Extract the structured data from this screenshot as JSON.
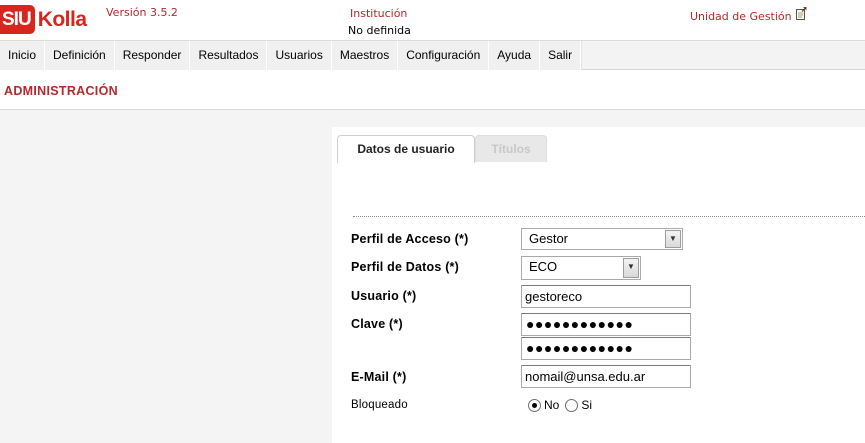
{
  "header": {
    "logo_left": "SIU",
    "logo_right": "Kolla",
    "version": "Versión 3.5.2",
    "institution_label": "Institución",
    "institution_value": "No definida",
    "unit_label": "Unidad de Gestión",
    "unit_icon": "edit-note-icon"
  },
  "menu": {
    "items": [
      {
        "label": "Inicio"
      },
      {
        "label": "Definición"
      },
      {
        "label": "Responder"
      },
      {
        "label": "Resultados"
      },
      {
        "label": "Usuarios"
      },
      {
        "label": "Maestros"
      },
      {
        "label": "Configuración"
      },
      {
        "label": "Ayuda"
      },
      {
        "label": "Salir"
      }
    ]
  },
  "page": {
    "title": "ADMINISTRACIÓN"
  },
  "tabs": {
    "active": "Datos de usuario",
    "inactive": "Títulos"
  },
  "form": {
    "perfil_acceso": {
      "label": "Perfil de Acceso (*)",
      "value": "Gestor"
    },
    "perfil_datos": {
      "label": "Perfil de Datos (*)",
      "value": "ECO"
    },
    "usuario": {
      "label": "Usuario (*)",
      "value": "gestoreco"
    },
    "clave": {
      "label": "Clave (*)",
      "value": "●●●●●●●●●●●●",
      "confirm_value": "●●●●●●●●●●●●"
    },
    "email": {
      "label": "E-Mail (*)",
      "value": "nomail@unsa.edu.ar"
    },
    "bloqueado": {
      "label": "Bloqueado",
      "option_no": "No",
      "option_si": "Si",
      "selected": "No"
    }
  },
  "colors": {
    "accent": "#b5282b",
    "logo_red": "#d7261e"
  }
}
